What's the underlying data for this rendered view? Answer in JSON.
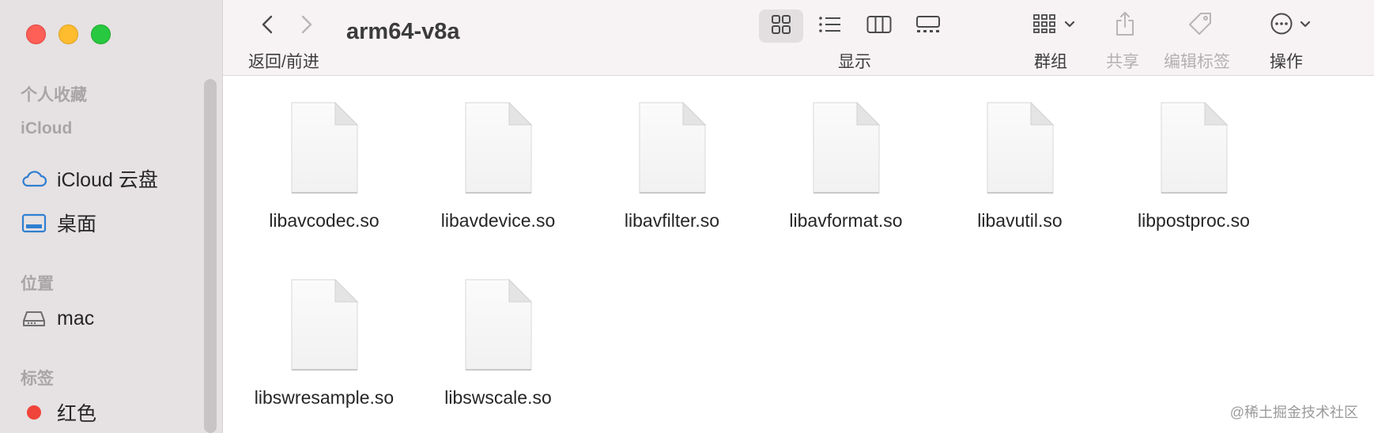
{
  "sidebar": {
    "favorites_title": "个人收藏",
    "icloud_title": "iCloud",
    "icloud_items": [
      {
        "label": "iCloud 云盘",
        "icon": "cloud-icon"
      },
      {
        "label": "桌面",
        "icon": "desktop-icon"
      }
    ],
    "locations_title": "位置",
    "location_items": [
      {
        "label": "mac",
        "icon": "drive-icon"
      }
    ],
    "tags_title": "标签",
    "tag_items": [
      {
        "label": "红色",
        "color": "#f0443b"
      }
    ]
  },
  "toolbar": {
    "back_forward_label": "返回/前进",
    "title": "arm64-v8a",
    "view_label": "显示",
    "group_label": "群组",
    "share_label": "共享",
    "tags_label": "编辑标签",
    "action_label": "操作"
  },
  "files": [
    "libavcodec.so",
    "libavdevice.so",
    "libavfilter.so",
    "libavformat.so",
    "libavutil.so",
    "libpostproc.so",
    "libswresample.so",
    "libswscale.so"
  ],
  "watermark": "@稀土掘金技术社区"
}
